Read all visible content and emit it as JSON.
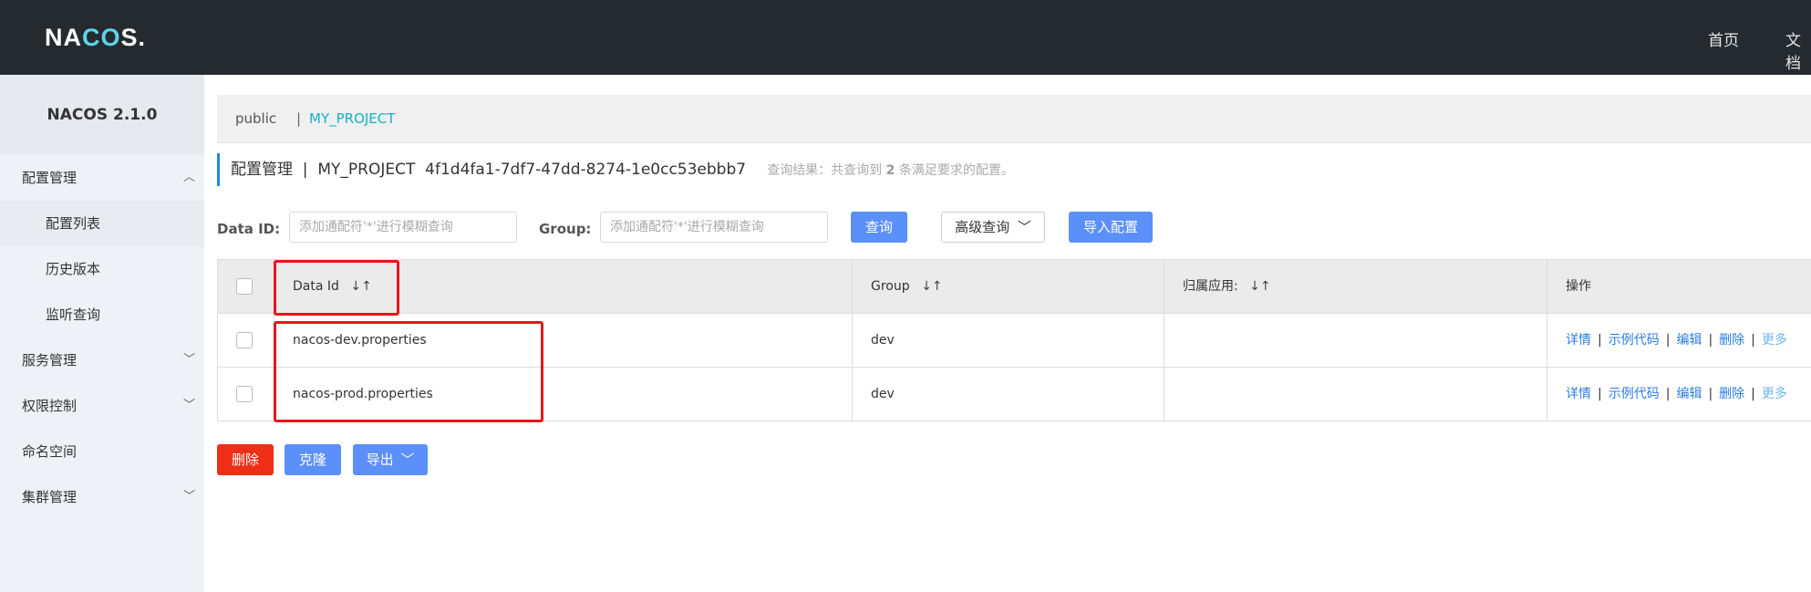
{
  "header": {
    "logo": "NACOS.",
    "nav": [
      "首页",
      "文档"
    ]
  },
  "sidebar": {
    "version": "NACOS 2.1.0",
    "items": [
      {
        "label": "配置管理",
        "type": "group",
        "expanded": true
      },
      {
        "label": "配置列表",
        "type": "sub",
        "active": true
      },
      {
        "label": "历史版本",
        "type": "sub"
      },
      {
        "label": "监听查询",
        "type": "sub"
      },
      {
        "label": "服务管理",
        "type": "group",
        "expanded": false
      },
      {
        "label": "权限控制",
        "type": "group",
        "expanded": false
      },
      {
        "label": "命名空间",
        "type": "link"
      },
      {
        "label": "集群管理",
        "type": "group",
        "expanded": false
      }
    ]
  },
  "namespace_bar": {
    "public": "public",
    "separator": "|",
    "current": "MY_PROJECT"
  },
  "title": {
    "main": "配置管理  |  MY_PROJECT  4f1d4fa1-7df7-47dd-8274-1e0cc53ebbb7",
    "hint_prefix": "查询结果：共查询到",
    "hint_count": "2",
    "hint_suffix": "条满足要求的配置。"
  },
  "filters": {
    "data_id_label": "Data ID:",
    "data_id_placeholder": "添加通配符'*'进行模糊查询",
    "group_label": "Group:",
    "group_placeholder": "添加通配符'*'进行模糊查询",
    "query_btn": "查询",
    "advanced_btn": "高级查询",
    "import_btn": "导入配置"
  },
  "table": {
    "columns": [
      "Data Id",
      "Group",
      "归属应用:",
      "操作"
    ],
    "sort_icon": "↓↑",
    "rows": [
      {
        "data_id": "nacos-dev.properties",
        "group": "dev",
        "app": ""
      },
      {
        "data_id": "nacos-prod.properties",
        "group": "dev",
        "app": ""
      }
    ],
    "ops": [
      "详情",
      "示例代码",
      "编辑",
      "删除",
      "更多"
    ],
    "op_sep": "|"
  },
  "bottom": {
    "delete_btn": "删除",
    "clone_btn": "克隆",
    "export_btn": "导出"
  },
  "colors": {
    "topbar": "#252a2f",
    "accent": "#5b8ff9",
    "danger": "#ef2e16",
    "highlight": "#e8151b"
  }
}
